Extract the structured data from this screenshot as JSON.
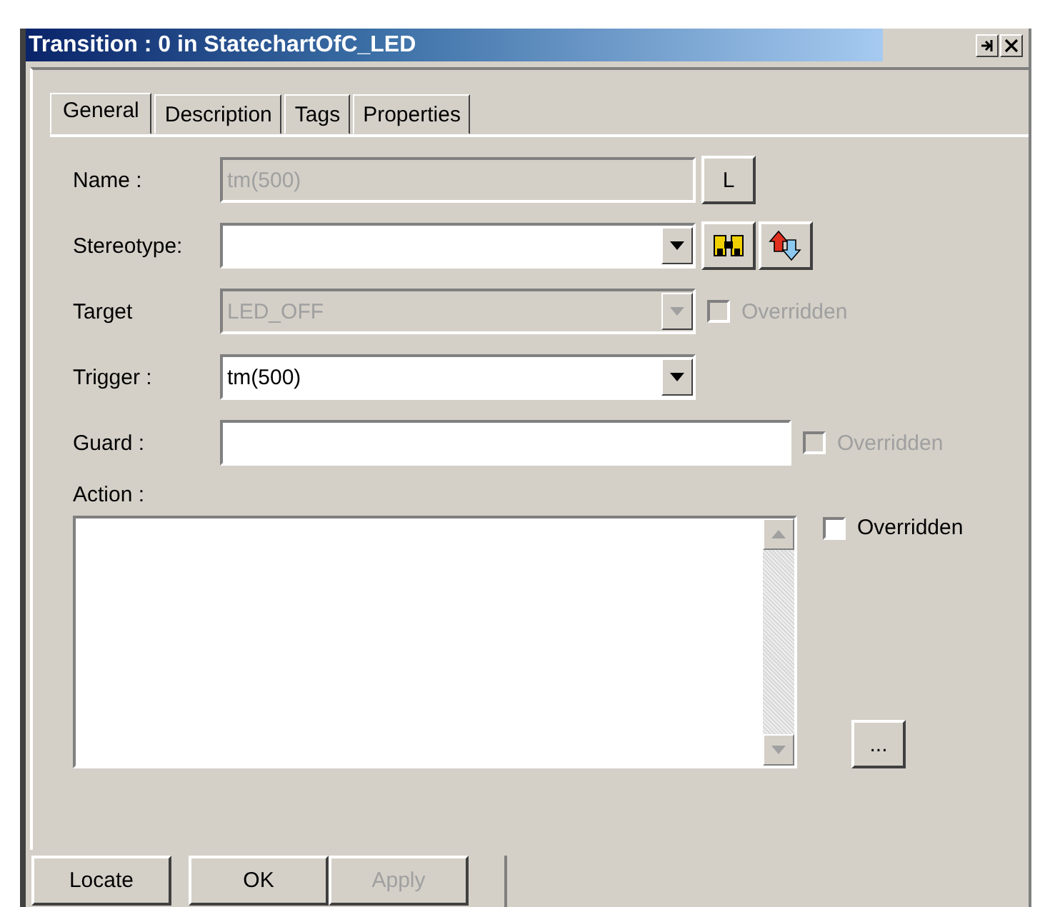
{
  "window": {
    "title": "Transition : 0 in StatechartOfC_LED"
  },
  "tabs": [
    {
      "label": "General",
      "selected": true
    },
    {
      "label": "Description",
      "selected": false
    },
    {
      "label": "Tags",
      "selected": false
    },
    {
      "label": "Properties",
      "selected": false
    }
  ],
  "name": {
    "label": "Name :",
    "value": "tm(500)",
    "disabled": true,
    "button": "L"
  },
  "stereotype": {
    "label": "Stereotype:"
  },
  "target": {
    "label": "Target",
    "value": "LED_OFF",
    "disabled": true,
    "overridden": {
      "label": "Overridden",
      "checked": false,
      "disabled": true
    }
  },
  "trigger": {
    "label": "Trigger :",
    "value": "tm(500)",
    "disabled": false
  },
  "guard": {
    "label": "Guard :",
    "overridden": {
      "label": "Overridden",
      "checked": false,
      "disabled": true
    }
  },
  "action": {
    "label": "Action :",
    "overridden": {
      "label": "Overridden",
      "checked": false,
      "disabled": false
    },
    "more_button": "..."
  },
  "buttons": [
    {
      "label": "Locate",
      "disabled": false
    },
    {
      "label": "OK",
      "disabled": false
    },
    {
      "label": "Apply",
      "disabled": true
    }
  ]
}
